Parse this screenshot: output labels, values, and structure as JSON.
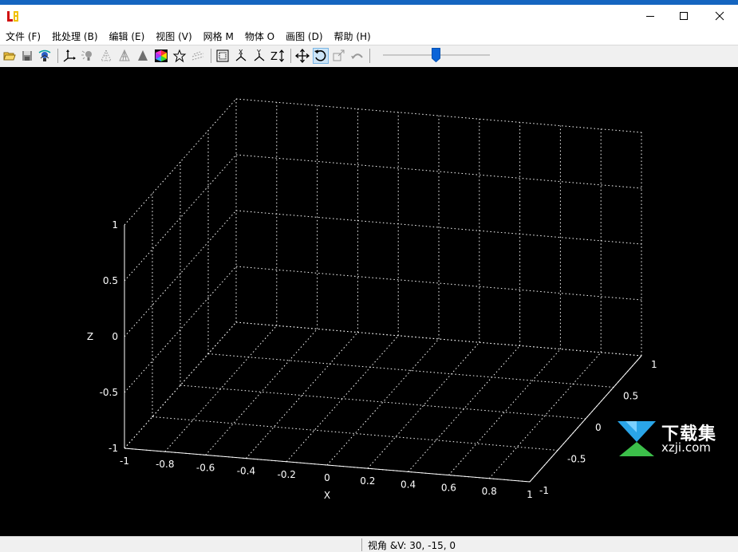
{
  "window": {
    "logo_text": "L8"
  },
  "menu": [
    "文件 (F)",
    "批处理 (B)",
    "编辑 (E)",
    "视图 (V)",
    "网格 M",
    "物体 O",
    "画图 (D)",
    "帮助 (H)"
  ],
  "toolbar": {
    "buttons": [
      "open",
      "save",
      "satellite",
      "axes",
      "light",
      "mesh-dots",
      "mesh-cone",
      "cone-solid",
      "color-palette",
      "star",
      "scatter",
      "box",
      "axis-x",
      "axis-y",
      "axis-z",
      "move",
      "rotate",
      "scale",
      "undo-rotate"
    ],
    "slider_value": 0.5
  },
  "plot": {
    "x_label": "X",
    "z_label": "Z",
    "x_ticks": [
      "-1",
      "-0.8",
      "-0.6",
      "-0.4",
      "-0.2",
      "0",
      "0.2",
      "0.4",
      "0.6",
      "0.8",
      "1"
    ],
    "y_ticks": [
      "-1",
      "-0.5",
      "0",
      "0.5",
      "1"
    ],
    "z_ticks": [
      "-1",
      "-0.5",
      "0",
      "0.5",
      "1"
    ],
    "view_azimuth": 30,
    "view_elevation": -15,
    "grid": true,
    "colors": {
      "background": "#000000",
      "axes": "#ffffff",
      "grid": "#ffffff"
    }
  },
  "status": {
    "text": "视角 &V: 30, -15, 0"
  },
  "watermark": {
    "title": "下载集",
    "url": "xzji.com"
  }
}
